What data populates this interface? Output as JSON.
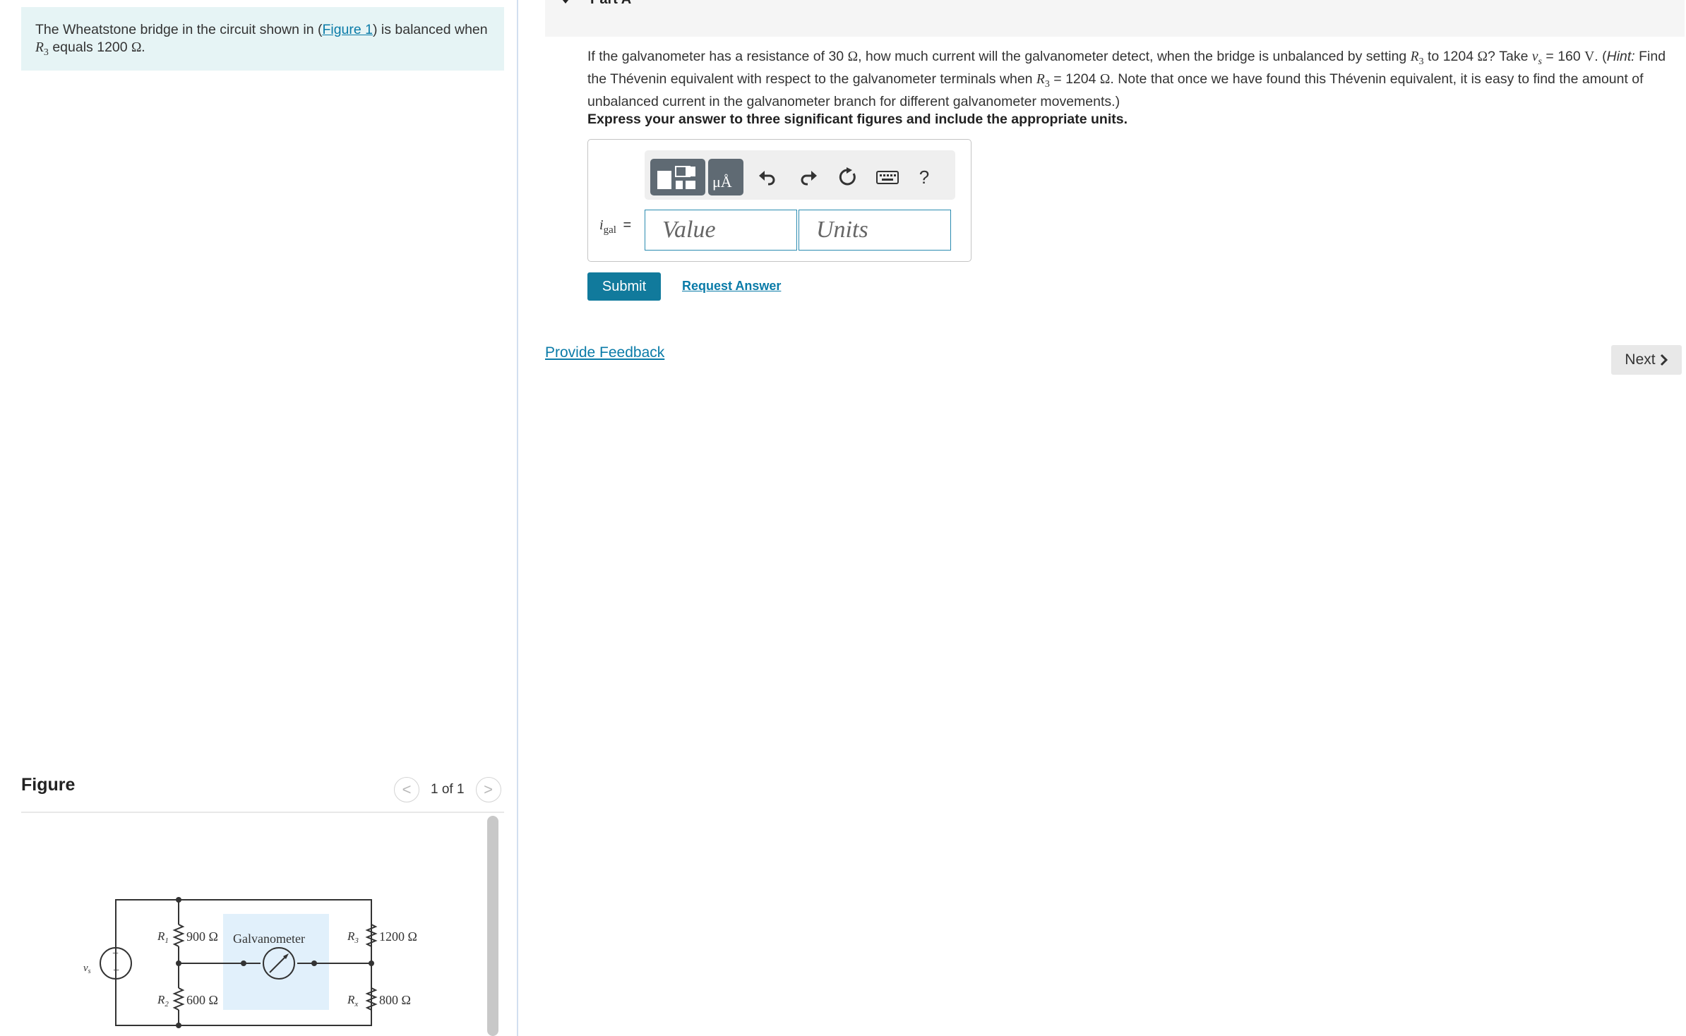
{
  "intro": {
    "text_before_link": "The Wheatstone bridge in the circuit shown in (",
    "link": "Figure 1",
    "text_after_link": ") is balanced when",
    "r3_var": "R",
    "r3_sub": "3",
    "r3_text": " equals 1200 ",
    "r3_unit": "Ω."
  },
  "part": {
    "title": "Part A"
  },
  "question": {
    "s1": "If the galvanometer has a resistance of 30 ",
    "ohm": "Ω",
    "s2": ", how much current will the galvanometer detect, when the bridge is unbalanced by setting ",
    "r3_var": "R",
    "r3_sub": "3",
    "s3": " to 1204 ",
    "s4": "? Take ",
    "vs_var": "v",
    "vs_sub": "s",
    "s5": " = 160 ",
    "volt": "V",
    "s6": ". (",
    "hint": "Hint:",
    "s7": " Find the Thévenin  equivalent with respect to the galvanometer terminals when ",
    "s8": " = 1204 ",
    "s9": ". Note that once we have found this Thévenin equivalent, it is easy to find the amount of unbalanced current in the galvanometer branch for different galvanometer movements.)"
  },
  "instructions": "Express your answer to three significant figures and include the appropriate units.",
  "answer": {
    "var_name": "i",
    "var_sub": "gal",
    "equals": "=",
    "value_placeholder": "Value",
    "units_placeholder": "Units",
    "toolbar_units_glyph": "μÅ",
    "help_glyph": "?"
  },
  "buttons": {
    "submit": "Submit",
    "request_answer": "Request Answer",
    "provide_feedback": "Provide Feedback",
    "next": "Next"
  },
  "figure": {
    "heading": "Figure",
    "counter": "1 of 1",
    "prev_glyph": "<",
    "next_glyph": ">",
    "source_label": "v",
    "source_sub": "s",
    "r1_label": "R",
    "r1_sub": "1",
    "r1_value": "900 Ω",
    "r2_label": "R",
    "r2_sub": "2",
    "r2_value": "600 Ω",
    "r3_label": "R",
    "r3_sub": "3",
    "r3_value": "1200 Ω",
    "rx_label": "R",
    "rx_sub": "x",
    "rx_value": "800 Ω",
    "galvanometer_label": "Galvanometer"
  },
  "colors": {
    "accent": "#117a9c",
    "link": "#0a7ba8",
    "intro_bg": "#e6f4f5",
    "input_border": "#2a8bb0",
    "galvanometer_bg": "#e1f0fb"
  }
}
